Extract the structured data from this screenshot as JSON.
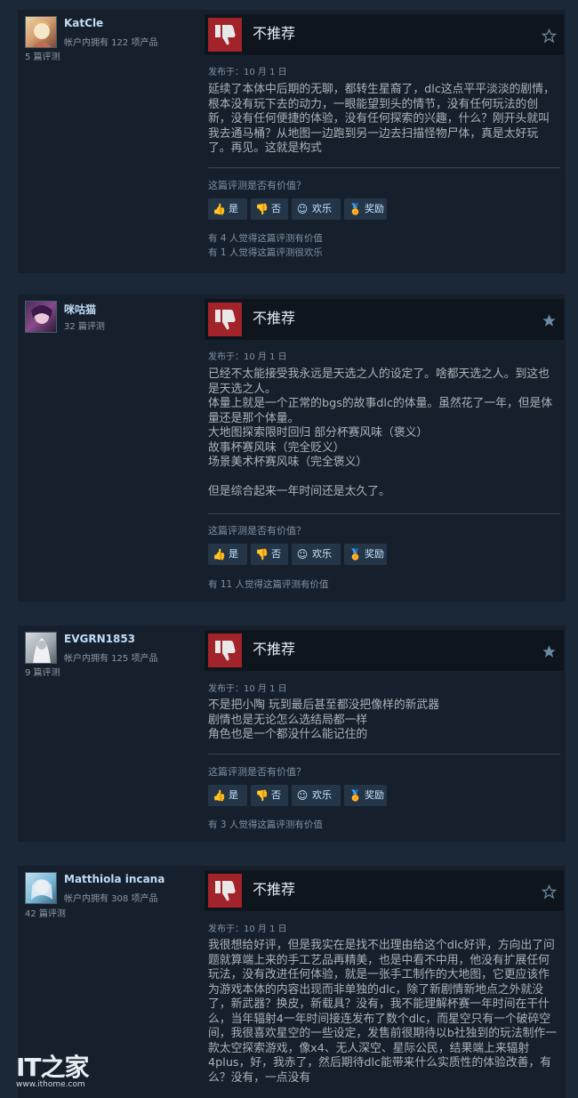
{
  "reviews": [
    {
      "username": "KatCle",
      "products_owned": "帐户内拥有 122 项产品",
      "review_count": "5 篇评测",
      "verdict": "不推荐",
      "date": "发布于：10 月 1 日",
      "body": "延续了本体中后期的无聊，都转生星裔了，dlc这点平平淡淡的剧情，根本没有玩下去的动力，一眼能望到头的情节，没有任何玩法的创新，没有任何便捷的体验，没有任何探索的兴趣，什么？刚开头就叫我去通马桶？从地图一边跑到另一边去扫描怪物尸体，真是太好玩了。再见。这就是构式",
      "helpful_question": "这篇评测是否有价值？",
      "btn_yes": "是",
      "btn_no": "否",
      "btn_funny": "欢乐",
      "btn_award": "奖励",
      "stat1": "有 4 人觉得这篇评测有价值",
      "stat2": "有 1 人觉得这篇评测很欢乐",
      "star_filled": false
    },
    {
      "username": "咪咕猫",
      "products_owned": "",
      "review_count": "32 篇评测",
      "verdict": "不推荐",
      "date": "发布于：10 月 1 日",
      "body": "已经不太能接受我永远是天选之人的设定了。啥都天选之人。到这也是天选之人。\n体量上就是一个正常的bgs的故事dlc的体量。虽然花了一年，但是体量还是那个体量。\n大地图探索限时回归 部分杯赛风味（褒义）\n故事杯赛风味（完全贬义）\n场景美术杯赛风味（完全褒义）\n\n但是综合起来一年时间还是太久了。",
      "helpful_question": "这篇评测是否有价值？",
      "btn_yes": "是",
      "btn_no": "否",
      "btn_funny": "欢乐",
      "btn_award": "奖励",
      "stat1": "有 11 人觉得这篇评测有价值",
      "stat2": "",
      "star_filled": true
    },
    {
      "username": "EVGRN1853",
      "products_owned": "帐户内拥有 125 项产品",
      "review_count": "9 篇评测",
      "verdict": "不推荐",
      "date": "发布于：10 月 1 日",
      "body": "不是把小陶 玩到最后甚至都没把像样的新武器\n剧情也是无论怎么选结局都一样\n角色也是一个都没什么能记住的",
      "helpful_question": "这篇评测是否有价值？",
      "btn_yes": "是",
      "btn_no": "否",
      "btn_funny": "欢乐",
      "btn_award": "奖励",
      "stat1": "有 3 人觉得这篇评测有价值",
      "stat2": "",
      "star_filled": true
    },
    {
      "username": "Matthiola incana",
      "products_owned": "帐户内拥有 308 项产品",
      "review_count": "42 篇评测",
      "verdict": "不推荐",
      "date": "发布于：10 月 1 日",
      "body": "我很想给好评，但是我实在是找不出理由给这个dlc好评，方向出了问题就算端上来的手工艺品再精美，也是中看不中用，他没有扩展任何玩法，没有改进任何体验，就是一张手工制作的大地图，它更应该作为游戏本体的内容出现而非单独的dlc，除了新剧情新地点之外就没了，新武器？换皮，新载具？没有，我不能理解杯赛一年时间在干什么，当年辐射4一年时间接连发布了数个dlc，而星空只有一个破碎空间，我很喜欢星空的一些设定，发售前很期待以b社独到的玩法制作一款太空探索游戏，像x4、无人深空、星际公民，结果端上来辐射4plus，好，我赤了，然后期待dlc能带来什么实质性的体验改善，有么？没有，一点没有",
      "star_filled": false
    }
  ],
  "watermark": {
    "logo": "IT之家",
    "url": "www.ithome.com"
  }
}
